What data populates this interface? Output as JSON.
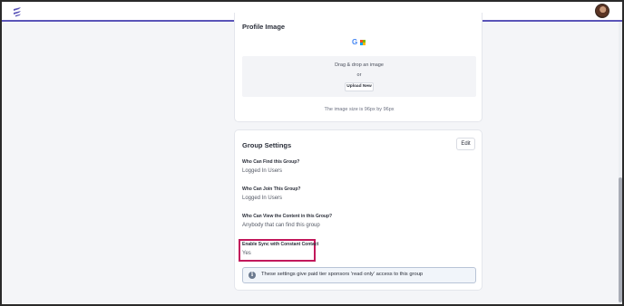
{
  "colors": {
    "accent": "#5a54b8",
    "highlight_border": "#c2185b",
    "google_blue": "#4285f4",
    "ms_red": "#f25022",
    "ms_green": "#7fba00",
    "ms_blue": "#00a4ef",
    "ms_yellow": "#ffb900"
  },
  "header": {
    "logo_icon": "lightning-logo-icon",
    "avatar_icon": "user-avatar"
  },
  "profile_image": {
    "title": "Profile Image",
    "google_glyph": "G",
    "dropzone": {
      "line1": "Drag & drop an image",
      "line2": "or",
      "upload_label": "Upload New"
    },
    "size_note": "The image size is 96px by 96px"
  },
  "group_settings": {
    "title": "Group Settings",
    "edit_label": "Edit",
    "fields": [
      {
        "label": "Who Can Find this Group?",
        "value": "Logged In Users"
      },
      {
        "label": "Who Can Join This Group?",
        "value": "Logged In Users"
      },
      {
        "label": "Who Can View the Content in this Group?",
        "value": "Anybody that can find this group"
      },
      {
        "label": "Enable Sync with Constant Contact",
        "value": "Yes"
      }
    ],
    "notice": {
      "icon": "info-icon",
      "text": "These settings give paid tier sponsors 'read only' access to this group"
    }
  }
}
